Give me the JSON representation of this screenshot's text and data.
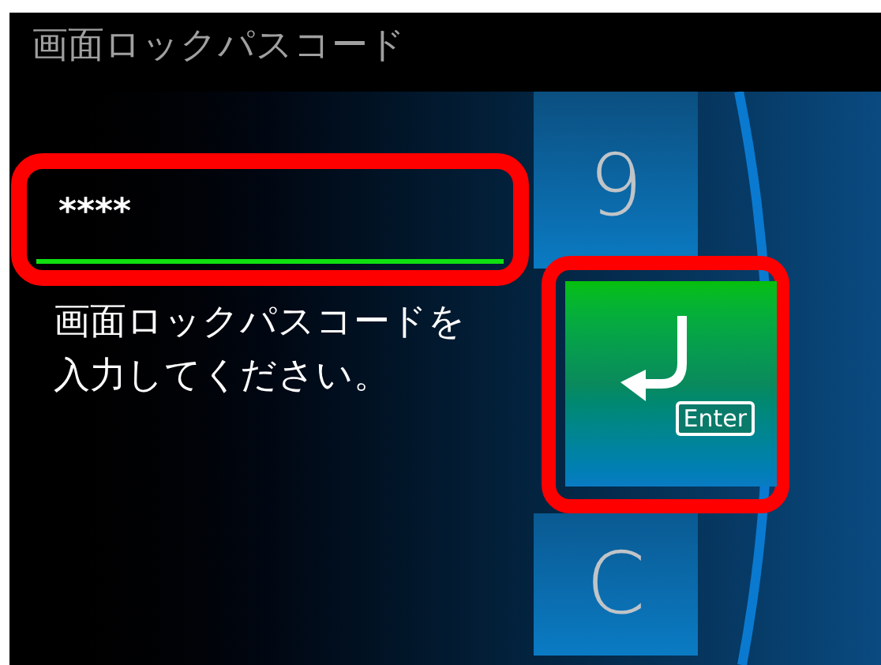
{
  "title": "画面ロックパスコード",
  "passcode_field": {
    "value": "****"
  },
  "instruction": "画面ロックパスコードを入力してください。",
  "keys": [
    {
      "kind": "digit",
      "label": "9"
    },
    {
      "kind": "enter",
      "label": "Enter"
    },
    {
      "kind": "clear",
      "label": "C"
    }
  ]
}
